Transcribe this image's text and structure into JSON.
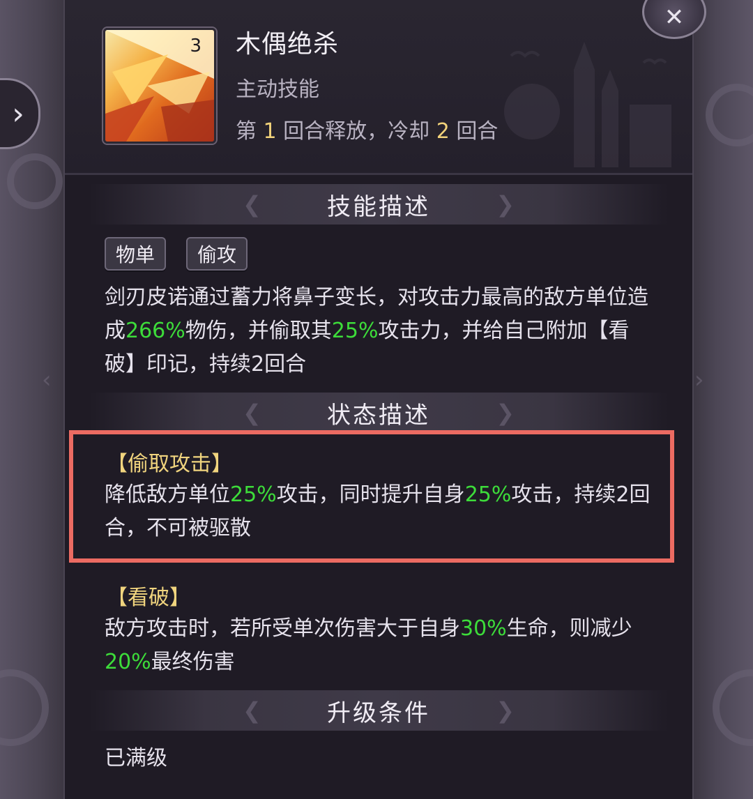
{
  "skill": {
    "name": "木偶绝杀",
    "type": "主动技能",
    "level": "3",
    "cooldown": {
      "prefix": "第 ",
      "release_round": "1",
      "mid": " 回合释放，冷却 ",
      "cooldown_rounds": "2",
      "suffix": " 回合"
    }
  },
  "sections": {
    "skill_desc": "技能描述",
    "status_desc": "状态描述",
    "upgrade": "升级条件"
  },
  "tags": [
    "物单",
    "偷攻"
  ],
  "skill_description": {
    "p1": "剑刃皮诺通过蓄力将鼻子变长，对攻击力最高的敌方单位造成",
    "v1": "266%",
    "p2": "物伤，并偷取其",
    "v2": "25%",
    "p3": "攻击力，并给自己附加【看破】印记，持续2回合"
  },
  "statuses": [
    {
      "title": "【偷取攻击】",
      "p1": "降低敌方单位",
      "v1": "25%",
      "p2": "攻击，同时提升自身",
      "v2": "25%",
      "p3": "攻击，持续2回合，不可被驱散"
    },
    {
      "title": "【看破】",
      "p1": "敌方攻击时，若所受单次伤害大于自身",
      "v1": "30%",
      "p2": "生命，则减少",
      "v2": "20%",
      "p3": "最终伤害"
    }
  ],
  "upgrade_text": "已满级",
  "icons": {
    "close": "close-crossed-swords-icon",
    "nav": "chevron-right-icon"
  },
  "colors": {
    "highlight": "#3ddc3a",
    "gold": "#f1d27a",
    "annotation_box": "#ec6b62"
  }
}
